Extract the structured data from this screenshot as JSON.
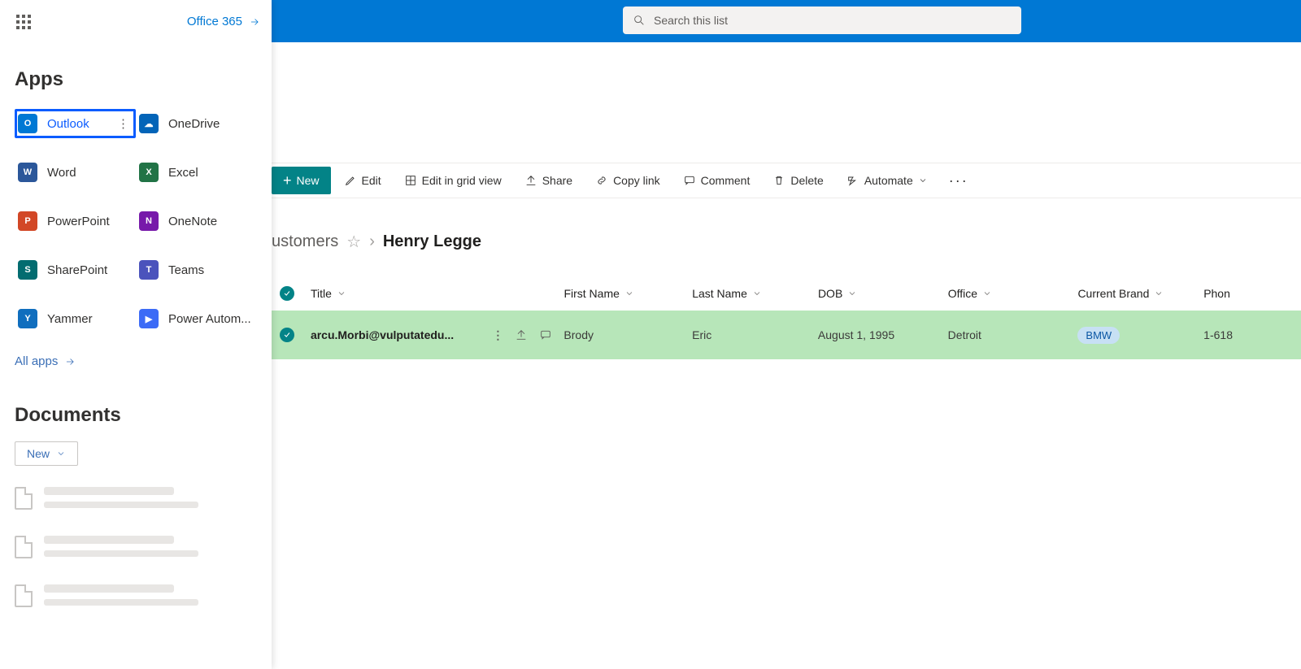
{
  "header": {
    "search_placeholder": "Search this list"
  },
  "toolbar": {
    "new": "New",
    "edit": "Edit",
    "edit_grid": "Edit in grid view",
    "share": "Share",
    "copy_link": "Copy link",
    "comment": "Comment",
    "delete": "Delete",
    "automate": "Automate",
    "more": "···"
  },
  "breadcrumb": {
    "parent_truncated": "ustomers",
    "current": "Henry Legge"
  },
  "columns": {
    "title": "Title",
    "first_name": "First Name",
    "last_name": "Last Name",
    "dob": "DOB",
    "office": "Office",
    "current_brand": "Current Brand",
    "phone": "Phon"
  },
  "row": {
    "title": "arcu.Morbi@vulputatedu...",
    "first_name": "Brody",
    "last_name": "Eric",
    "dob": "August 1, 1995",
    "office": "Detroit",
    "brand": "BMW",
    "phone": "1-618"
  },
  "launcher": {
    "office365": "Office 365",
    "apps_heading": "Apps",
    "apps": [
      {
        "name": "Outlook",
        "key": "outlook",
        "selected": true
      },
      {
        "name": "OneDrive",
        "key": "onedrive"
      },
      {
        "name": "Word",
        "key": "word"
      },
      {
        "name": "Excel",
        "key": "excel"
      },
      {
        "name": "PowerPoint",
        "key": "powerpoint"
      },
      {
        "name": "OneNote",
        "key": "onenote"
      },
      {
        "name": "SharePoint",
        "key": "sharepoint"
      },
      {
        "name": "Teams",
        "key": "teams"
      },
      {
        "name": "Yammer",
        "key": "yammer"
      },
      {
        "name": "Power Autom...",
        "key": "powerautomate"
      }
    ],
    "all_apps": "All apps",
    "documents_heading": "Documents",
    "new_doc": "New"
  }
}
